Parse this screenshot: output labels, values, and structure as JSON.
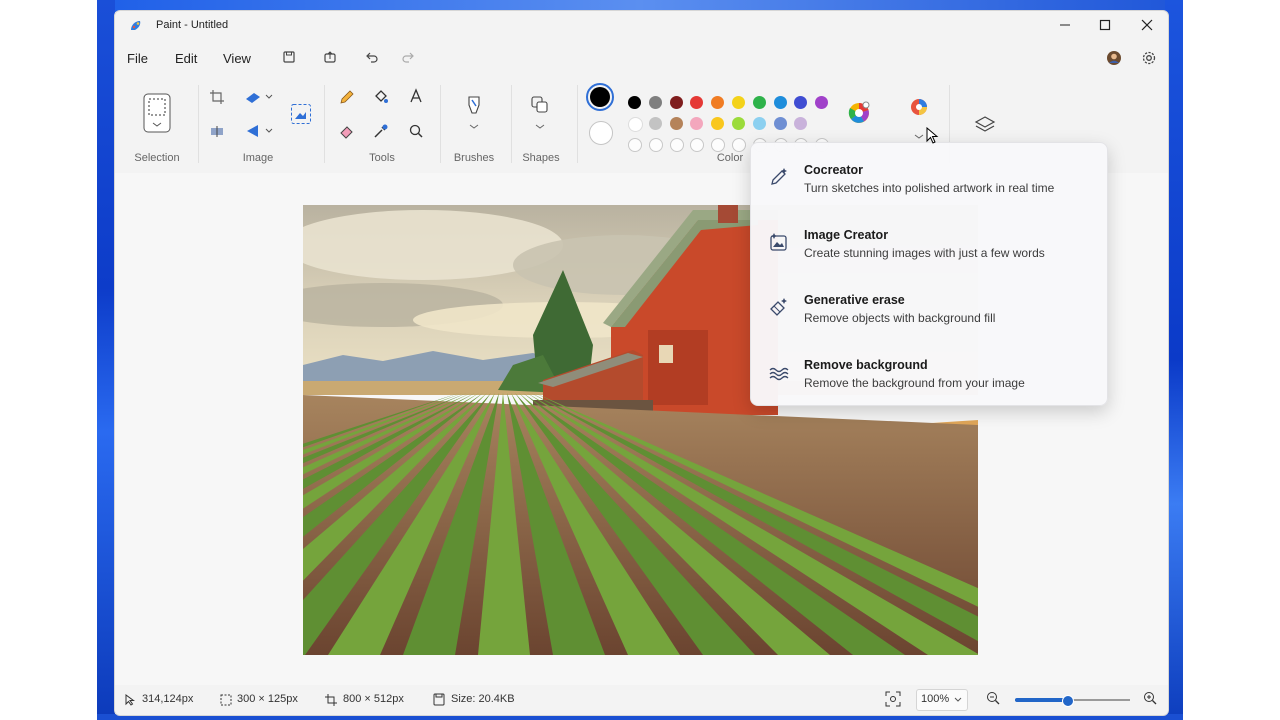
{
  "window": {
    "title": "Paint - Untitled"
  },
  "menu": {
    "file": "File",
    "edit": "Edit",
    "view": "View"
  },
  "ribbon": {
    "groups": {
      "selection": "Selection",
      "image": "Image",
      "tools": "Tools",
      "brushes": "Brushes",
      "shapes": "Shapes",
      "colors": "Color"
    },
    "palette_row1": [
      "#000000",
      "#7f7f7f",
      "#7f1d1d",
      "#e53935",
      "#f07c23",
      "#f3d21a",
      "#2eb24a",
      "#1e8ddb",
      "#3f4dd2",
      "#a041c9"
    ],
    "palette_row2": [
      "#ffffff",
      "#c3c3c3",
      "#b5835a",
      "#f3a7bd",
      "#f9c71d",
      "#9bdb3b",
      "#8cd0f0",
      "#6f8fd3",
      "#c9b2db"
    ],
    "primary_color": "#000000",
    "secondary_color": "#ffffff"
  },
  "cocreator_menu": {
    "items": [
      {
        "title": "Cocreator",
        "description": "Turn sketches into polished artwork in real time",
        "icon": "magic-pen-icon"
      },
      {
        "title": "Image Creator",
        "description": "Create stunning images with just a few words",
        "icon": "image-sparkle-icon"
      },
      {
        "title": "Generative erase",
        "description": "Remove objects with background fill",
        "icon": "eraser-sparkle-icon"
      },
      {
        "title": "Remove background",
        "description": "Remove the background from your image",
        "icon": "remove-background-icon"
      }
    ]
  },
  "status": {
    "cursor_pos": "314,124px",
    "selection_size": "300 × 125px",
    "canvas_size": "800 × 512px",
    "file_size": "Size: 20.4KB",
    "zoom": "100%",
    "zoom_fraction": 0.45
  }
}
